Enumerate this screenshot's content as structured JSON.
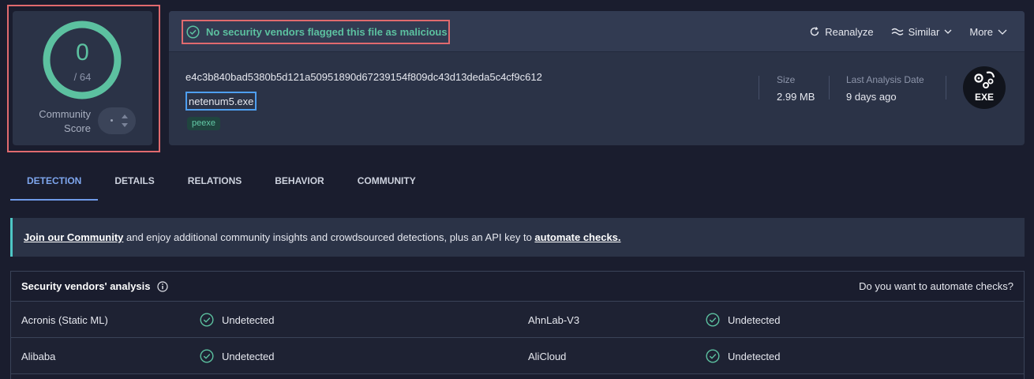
{
  "score": {
    "value": "0",
    "total": "/ 64",
    "community_label_line1": "Community",
    "community_label_line2": "Score",
    "ring_color": "#5cc1a0"
  },
  "banner": {
    "text": "No security vendors flagged this file as malicious"
  },
  "header_actions": {
    "reanalyze": "Reanalyze",
    "similar": "Similar",
    "more": "More"
  },
  "file": {
    "hash": "e4c3b840bad5380b5d121a50951890d67239154f809dc43d13deda5c4cf9c612",
    "name": "netenum5.exe",
    "tag": "peexe",
    "size_label": "Size",
    "size_value": "2.99 MB",
    "date_label": "Last Analysis Date",
    "date_value": "9 days ago",
    "type_icon_text": "EXE"
  },
  "tabs": [
    "DETECTION",
    "DETAILS",
    "RELATIONS",
    "BEHAVIOR",
    "COMMUNITY"
  ],
  "notice": {
    "link1": "Join our Community",
    "middle": " and enjoy additional community insights and crowdsourced detections, plus an API key to ",
    "link2": "automate checks."
  },
  "vendors": {
    "title": "Security vendors' analysis",
    "automate": "Do you want to automate checks?",
    "rows": [
      {
        "left_name": "Acronis (Static ML)",
        "left_status": "Undetected",
        "right_name": "AhnLab-V3",
        "right_status": "Undetected"
      },
      {
        "left_name": "Alibaba",
        "left_status": "Undetected",
        "right_name": "AliCloud",
        "right_status": "Undetected"
      }
    ]
  },
  "colors": {
    "accent_green": "#5cc1a0",
    "accent_blue": "#6f9ae8",
    "highlight_red": "#e06a6e",
    "highlight_blue": "#4e9ff0"
  }
}
